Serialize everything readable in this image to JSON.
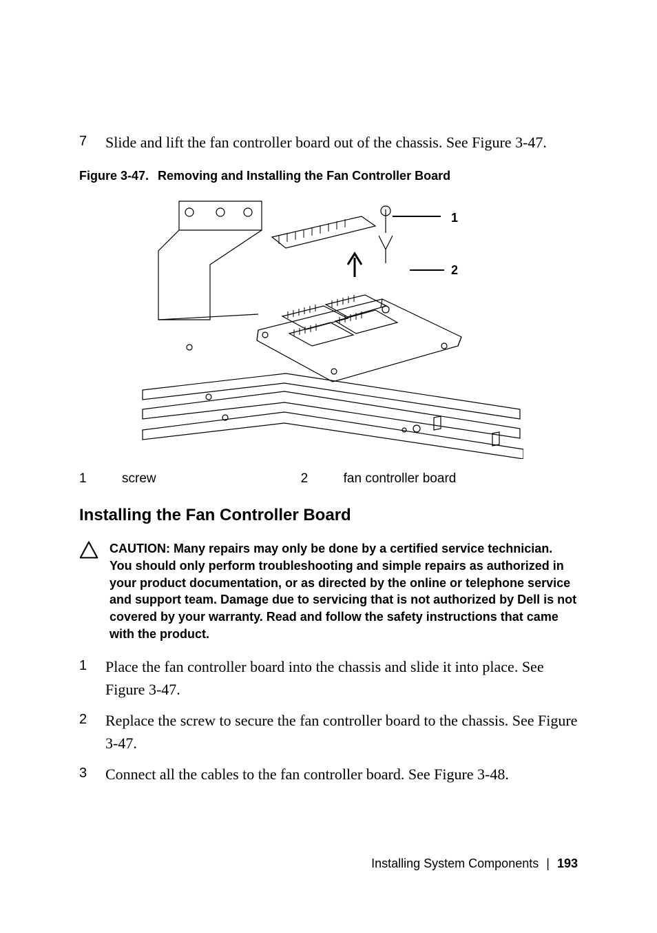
{
  "steps_top": [
    {
      "num": "7",
      "text": "Slide and lift the fan controller board out of the chassis. See Figure 3-47."
    }
  ],
  "figure": {
    "caption_prefix": "Figure 3-47.",
    "caption_title": "Removing and Installing the Fan Controller Board",
    "callouts": {
      "1": "1",
      "2": "2"
    },
    "legend": [
      {
        "num": "1",
        "label": "screw"
      },
      {
        "num": "2",
        "label": "fan controller board"
      }
    ]
  },
  "subheading": "Installing the Fan Controller Board",
  "caution": {
    "label": "CAUTION:",
    "text": "Many repairs may only be done by a certified service technician. You should only perform troubleshooting and simple repairs as authorized in your product documentation, or as directed by the online or telephone service and support team. Damage due to servicing that is not authorized by Dell is not covered by your warranty. Read and follow the safety instructions that came with the product."
  },
  "steps_bottom": [
    {
      "num": "1",
      "text": "Place the fan controller board into the chassis and slide it into place. See Figure 3-47."
    },
    {
      "num": "2",
      "text": "Replace the screw to secure the fan controller board to the chassis. See Figure 3-47."
    },
    {
      "num": "3",
      "text": "Connect all the cables to the fan controller board. See Figure 3-48."
    }
  ],
  "footer": {
    "section": "Installing System Components",
    "page": "193"
  }
}
